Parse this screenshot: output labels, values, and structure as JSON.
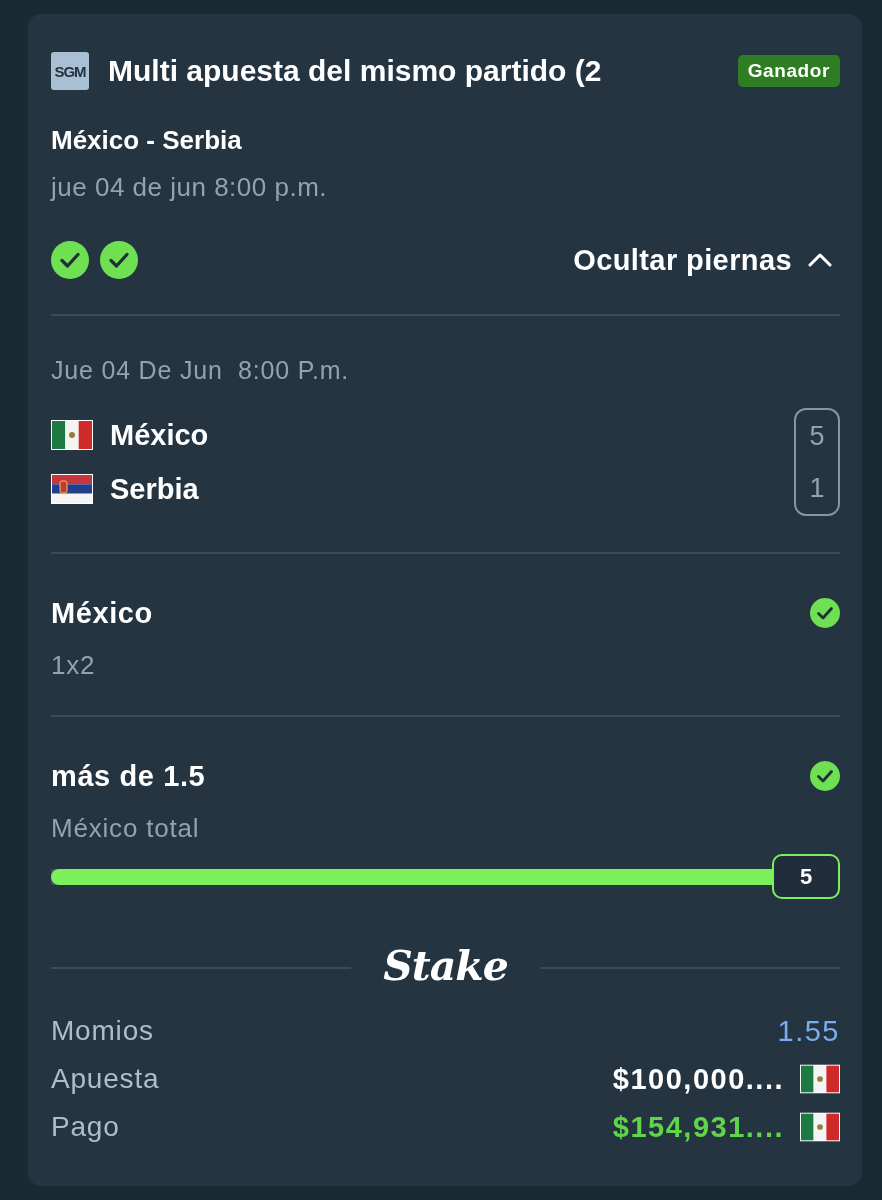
{
  "bet": {
    "type_badge": "SGM",
    "title": "Multi apuesta del mismo partido (2",
    "status": "Ganador",
    "match": "México - Serbia",
    "date": "jue 04 de jun 8:00 p.m."
  },
  "leg_marks": [
    {
      "won": true
    },
    {
      "won": true
    }
  ],
  "legs_toggle": {
    "label": "Ocultar piernas",
    "expanded": true
  },
  "event": {
    "date": "Jue 04 De Jun  8:00 P.m.",
    "teams": [
      {
        "name": "México",
        "flag": {
          "kind": "mexico"
        },
        "score": "5"
      },
      {
        "name": "Serbia",
        "flag": {
          "kind": "serbia"
        },
        "score": "1"
      }
    ]
  },
  "legs": [
    {
      "selection": "México",
      "market": "1x2",
      "won": true
    },
    {
      "selection": "más de 1.5",
      "market": "México total",
      "won": true,
      "progress": {
        "level": 1,
        "value": "5"
      }
    }
  ],
  "logo_text": "Stake",
  "summary": [
    {
      "label": "Momios",
      "value": "1.55",
      "kind": "odds"
    },
    {
      "label": "Apuesta",
      "value": "$100,000....",
      "kind": "stake",
      "flag": {
        "kind": "mexico"
      }
    },
    {
      "label": "Pago",
      "value": "$154,931....",
      "kind": "payout",
      "flag": {
        "kind": "mexico"
      }
    }
  ]
}
